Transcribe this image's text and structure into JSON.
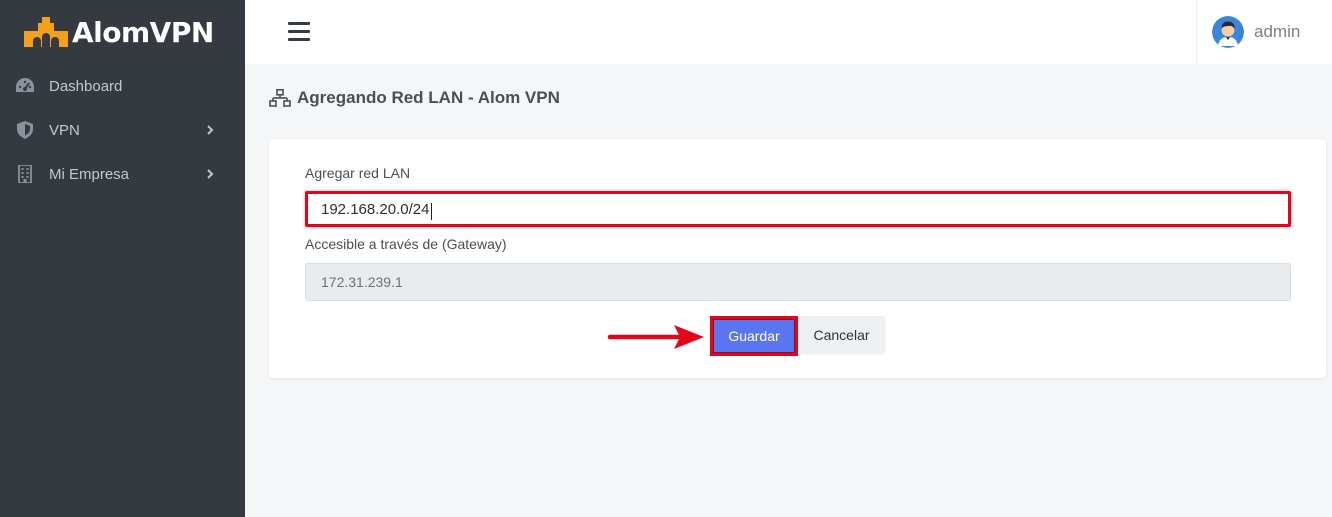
{
  "brand": {
    "name": "AlomVPN",
    "logo_color": "#f5a01a"
  },
  "sidebar": {
    "items": [
      {
        "label": "Dashboard",
        "icon": "tachometer-icon",
        "has_submenu": false
      },
      {
        "label": "VPN",
        "icon": "shield-icon",
        "has_submenu": true
      },
      {
        "label": "Mi Empresa",
        "icon": "building-icon",
        "has_submenu": true
      }
    ]
  },
  "topbar": {
    "menu_icon": "hamburger-icon",
    "user_name": "admin"
  },
  "page": {
    "icon": "network-icon",
    "title": "Agregando Red LAN - Alom VPN"
  },
  "form": {
    "lan_label": "Agregar red LAN",
    "lan_value": "192.168.20.0/24",
    "gateway_label": "Accesible a través de (Gateway)",
    "gateway_value": "172.31.239.1",
    "save_label": "Guardar",
    "cancel_label": "Cancelar"
  },
  "colors": {
    "sidebar_bg": "#343a40",
    "primary": "#5b75f2",
    "annotation_red": "#e2061b"
  }
}
